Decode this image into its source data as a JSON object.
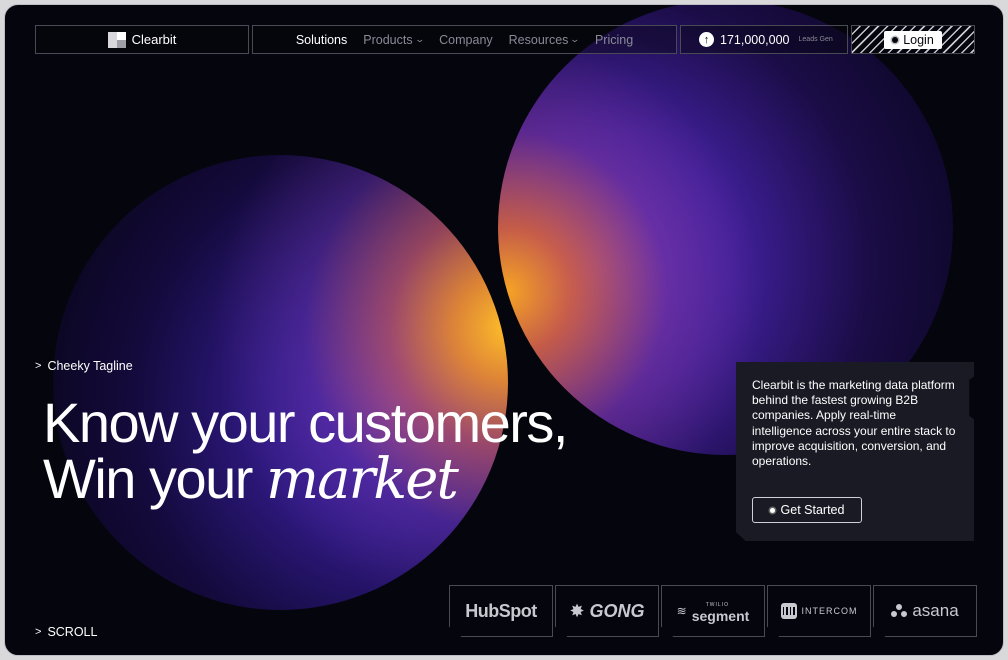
{
  "nav": {
    "brand": "Clearbit",
    "menu": [
      {
        "label": "Solutions",
        "active": true,
        "has_dropdown": false
      },
      {
        "label": "Products",
        "active": false,
        "has_dropdown": true
      },
      {
        "label": "Company",
        "active": false,
        "has_dropdown": false
      },
      {
        "label": "Resources",
        "active": false,
        "has_dropdown": true
      },
      {
        "label": "Pricing",
        "active": false,
        "has_dropdown": false
      }
    ],
    "counter_value": "171,000,000",
    "counter_label": "Leads Gen",
    "login_label": "Login"
  },
  "hero": {
    "tagline": "Cheeky Tagline",
    "headline_line1": "Know your customers,",
    "headline_line2_plain": "Win your",
    "headline_line2_italic": "market",
    "scroll_label": "SCROLL"
  },
  "card": {
    "text": "Clearbit is the marketing data platform behind the fastest growing B2B companies. Apply real-time intelligence across your entire stack to improve acquisition, conversion, and operations.",
    "cta_label": "Get Started"
  },
  "partners": {
    "hubspot": "HubSpot",
    "gong": "GONG",
    "segment_small": "TWILIO",
    "segment": "segment",
    "intercom": "INTERCOM",
    "asana": "asana"
  },
  "colors": {
    "background": "#05050d",
    "orb_purple": "#4d27b8",
    "orb_orange": "#ffbe28",
    "card": "#1a1a24"
  }
}
